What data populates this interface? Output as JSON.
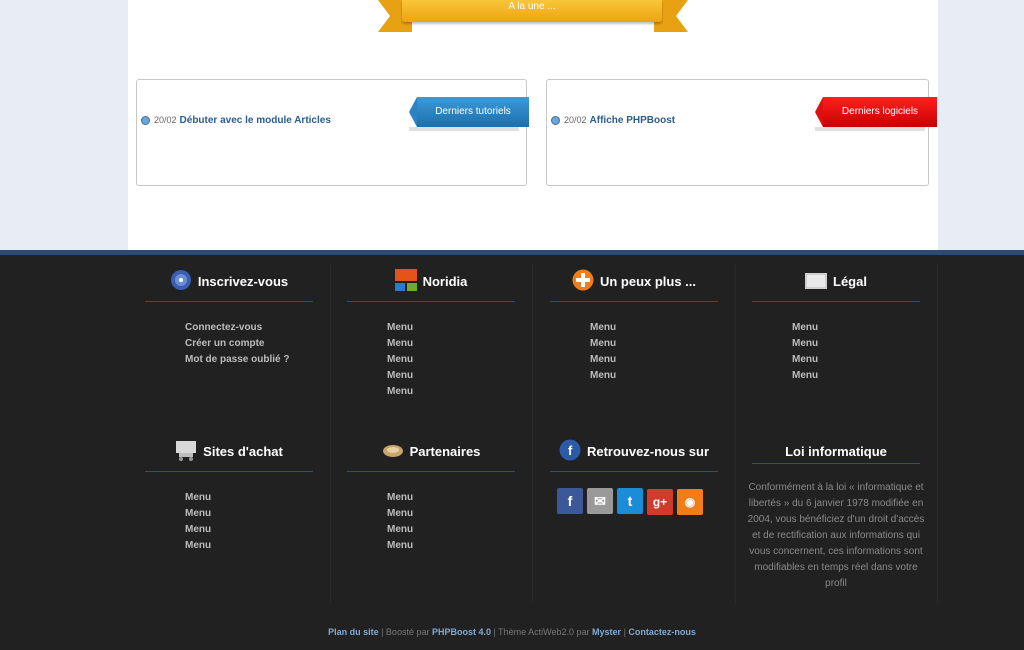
{
  "banner": {
    "label": "A la une ..."
  },
  "cards": [
    {
      "tag": "Derniers tutoriels",
      "date": "20/02",
      "title": "Débuter avec le module Articles",
      "color": "#2b8bcc"
    },
    {
      "tag": "Derniers logiciels",
      "date": "20/02",
      "title": "Affiche PHPBoost",
      "color": "#e00000"
    }
  ],
  "footer": {
    "row1": [
      {
        "title": "Inscrivez-vous",
        "icon": "user-register-icon",
        "items": [
          "Connectez-vous",
          "Créer un compte",
          "Mot de passe oublié ?"
        ]
      },
      {
        "title": "Noridia",
        "icon": "noridia-blocks-icon",
        "items": [
          "Menu",
          "Menu",
          "Menu",
          "Menu",
          "Menu"
        ]
      },
      {
        "title": "Un peux plus ...",
        "icon": "plus-icon",
        "items": [
          "Menu",
          "Menu",
          "Menu",
          "Menu"
        ]
      },
      {
        "title": "Légal",
        "icon": "legal-icon",
        "items": [
          "Menu",
          "Menu",
          "Menu",
          "Menu"
        ]
      }
    ],
    "row2": [
      {
        "title": "Sites d'achat",
        "icon": "cart-icon",
        "items": [
          "Menu",
          "Menu",
          "Menu",
          "Menu"
        ]
      },
      {
        "title": "Partenaires",
        "icon": "handshake-icon",
        "items": [
          "Menu",
          "Menu",
          "Menu",
          "Menu"
        ]
      },
      {
        "title": "Retrouvez-nous sur",
        "icon": "facebook-badge-icon",
        "socials": [
          "facebook-icon",
          "mail-icon",
          "twitter-icon",
          "googleplus-icon",
          "rss-icon"
        ]
      },
      {
        "title": "Loi informatique",
        "text": "Conformément à la loi « informatique et libertés » du 6 janvier 1978 modifiée en 2004, vous bénéficiez d'un droit d'accès et de rectification aux informations qui vous concernent, ces informations sont modifiables en temps réel dans votre profil"
      }
    ],
    "bottom": {
      "plan": "Plan du site",
      "sep1": " | Boosté par ",
      "phpboost": "PHPBoost 4.0",
      "sep2": " | Thème ActiWeb2.0 par ",
      "myster": "Myster",
      "sep3": " | ",
      "contact": "Contactez-nous"
    }
  }
}
